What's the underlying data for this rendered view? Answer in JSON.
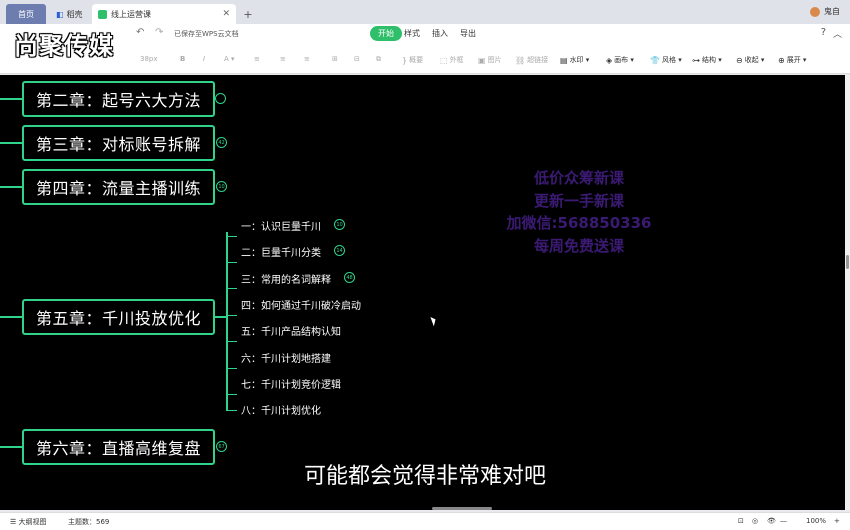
{
  "tabs": [
    {
      "label": "首页"
    },
    {
      "label": "稻壳"
    },
    {
      "label": "线上运营课"
    }
  ],
  "user": {
    "name": "鬼自"
  },
  "overlay": {
    "logo": "尚聚传媒"
  },
  "menu": {
    "saved_status": "已保存至WPS云文档",
    "tabs": [
      "开始",
      "样式",
      "插入",
      "导出"
    ],
    "help": "?"
  },
  "toolbar": {
    "font_size": "38px",
    "items": [
      "概要",
      "外框",
      "图片",
      "超链接",
      "水印",
      "画布",
      "风格",
      "结构",
      "收起",
      "展开"
    ]
  },
  "mindmap": {
    "chapters": [
      {
        "title": "第二章：起号六大方法",
        "badge": ""
      },
      {
        "title": "第三章：对标账号拆解",
        "badge": "42"
      },
      {
        "title": "第四章：流量主播训练",
        "badge": "10"
      },
      {
        "title": "第五章：千川投放优化",
        "badge": ""
      },
      {
        "title": "第六章：直播高维复盘",
        "badge": "67"
      }
    ],
    "subitems": [
      {
        "label": "一：认识巨量千川",
        "badge": "10"
      },
      {
        "label": "二：巨量千川分类",
        "badge": "14"
      },
      {
        "label": "三：常用的名词解释",
        "badge": "48"
      },
      {
        "label": "四：如何通过千川破冷启动",
        "badge": ""
      },
      {
        "label": "五：千川产品结构认知",
        "badge": ""
      },
      {
        "label": "六：千川计划地搭建",
        "badge": ""
      },
      {
        "label": "七：千川计划竞价逻辑",
        "badge": ""
      },
      {
        "label": "八：千川计划优化",
        "badge": ""
      }
    ]
  },
  "promo": [
    "低价众筹新课",
    "更新一手新课",
    "加微信:568850336",
    "每周免费送课"
  ],
  "subtitle": "可能都会觉得非常难对吧",
  "status": {
    "outline_view": "大纲视图",
    "topic_count": "主题数：569",
    "zoom": "100%"
  }
}
